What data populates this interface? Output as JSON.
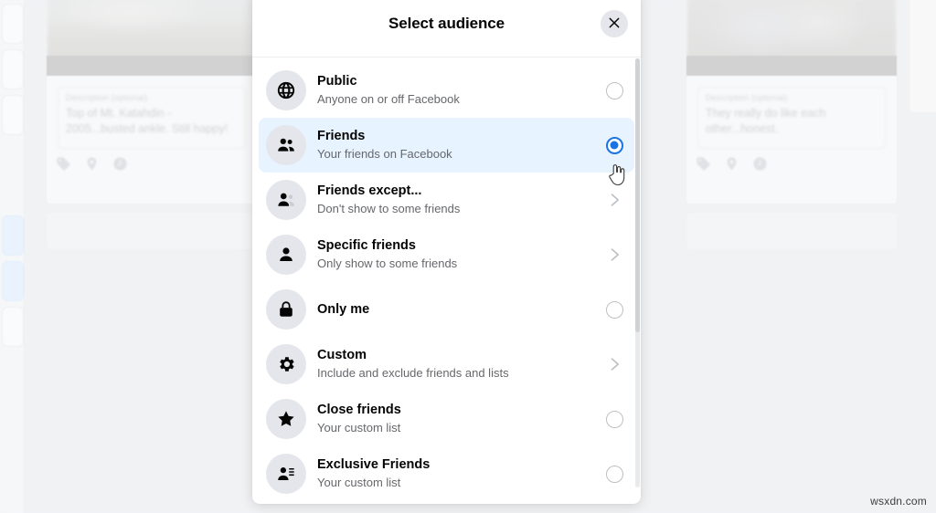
{
  "modal": {
    "title": "Select audience",
    "close_label": "Close",
    "close_icon": "close-icon",
    "options": [
      {
        "id": "public",
        "title": "Public",
        "subtitle": "Anyone on or off Facebook",
        "icon": "globe-icon",
        "control": "radio",
        "selected": false
      },
      {
        "id": "friends",
        "title": "Friends",
        "subtitle": "Your friends on Facebook",
        "icon": "two-people-icon",
        "control": "radio",
        "selected": true
      },
      {
        "id": "friends-except",
        "title": "Friends except...",
        "subtitle": "Don't show to some friends",
        "icon": "person-minus-icon",
        "control": "chevron",
        "selected": false
      },
      {
        "id": "specific-friends",
        "title": "Specific friends",
        "subtitle": "Only show to some friends",
        "icon": "person-icon",
        "control": "chevron",
        "selected": false
      },
      {
        "id": "only-me",
        "title": "Only me",
        "subtitle": "",
        "icon": "lock-icon",
        "control": "radio",
        "selected": false
      },
      {
        "id": "custom",
        "title": "Custom",
        "subtitle": "Include and exclude friends and lists",
        "icon": "gear-icon",
        "control": "chevron",
        "selected": false
      },
      {
        "id": "close-friends",
        "title": "Close friends",
        "subtitle": "Your custom list",
        "icon": "star-icon",
        "control": "radio",
        "selected": false
      },
      {
        "id": "exclusive-friends",
        "title": "Exclusive Friends",
        "subtitle": "Your custom list",
        "icon": "person-list-icon",
        "control": "radio",
        "selected": false
      }
    ]
  },
  "background": {
    "cards": [
      {
        "id": "left",
        "description_label": "Description (optional)",
        "description_text": "Top of Mt. Katahdin - 2005...busted ankle.  Still happy!"
      },
      {
        "id": "right",
        "description_label": "Description (optional)",
        "description_text": "They really do like each other...honest."
      }
    ],
    "card_icons": [
      "tag-icon",
      "location-pin-icon",
      "clock-icon"
    ]
  },
  "theme": {
    "accent": "#1b74e4",
    "selected_row_bg": "#e7f3ff",
    "page_bg": "#f0f2f5",
    "title_color": "#050505",
    "subtitle_color": "#65676b"
  },
  "watermark": "wsxdn.com"
}
